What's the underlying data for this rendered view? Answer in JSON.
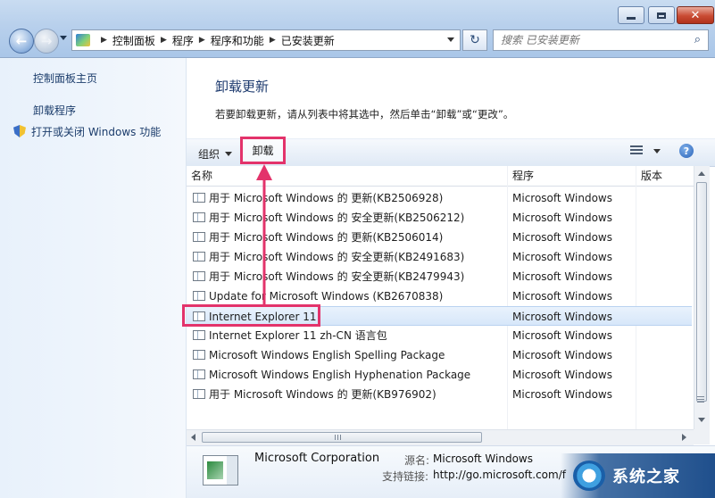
{
  "window": {
    "caption_buttons": [
      "minimize",
      "maximize",
      "close"
    ],
    "close_glyph": "✕"
  },
  "nav": {
    "back_icon": "back-arrow-icon",
    "forward_icon": "forward-arrow-icon",
    "breadcrumb": [
      "控制面板",
      "程序",
      "程序和功能",
      "已安装更新"
    ],
    "search_placeholder": "搜索 已安装更新"
  },
  "sidebar": {
    "items": [
      {
        "label": "控制面板主页"
      },
      {
        "label": "卸载程序"
      },
      {
        "label": "打开或关闭 Windows 功能",
        "icon": "shield-icon"
      }
    ]
  },
  "main": {
    "title": "卸载更新",
    "description": "若要卸载更新，请从列表中将其选中，然后单击“卸载”或“更改”。"
  },
  "toolbar": {
    "organize_label": "组织",
    "uninstall_label": "卸载",
    "help_glyph": "?"
  },
  "table": {
    "columns": [
      "名称",
      "程序",
      "版本"
    ],
    "rows": [
      {
        "name": "用于 Microsoft Windows 的 更新(KB2506928)",
        "program": "Microsoft Windows"
      },
      {
        "name": "用于 Microsoft Windows 的 安全更新(KB2506212)",
        "program": "Microsoft Windows"
      },
      {
        "name": "用于 Microsoft Windows 的 更新(KB2506014)",
        "program": "Microsoft Windows"
      },
      {
        "name": "用于 Microsoft Windows 的 安全更新(KB2491683)",
        "program": "Microsoft Windows"
      },
      {
        "name": "用于 Microsoft Windows 的 安全更新(KB2479943)",
        "program": "Microsoft Windows"
      },
      {
        "name": "Update for Microsoft Windows (KB2670838)",
        "program": "Microsoft Windows"
      },
      {
        "name": "Internet Explorer 11",
        "program": "Microsoft Windows",
        "selected": true
      },
      {
        "name": "Internet Explorer 11 zh-CN 语言包",
        "program": "Microsoft Windows"
      },
      {
        "name": "Microsoft Windows English Spelling Package",
        "program": "Microsoft Windows"
      },
      {
        "name": "Microsoft Windows English Hyphenation Package",
        "program": "Microsoft Windows"
      },
      {
        "name": "用于 Microsoft Windows 的 更新(KB976902)",
        "program": "Microsoft Windows"
      }
    ]
  },
  "details": {
    "company": "Microsoft Corporation",
    "source_label": "源名:",
    "source_value": "Microsoft Windows",
    "support_label": "支持链接:",
    "support_value": "http://go.microsoft.com/f"
  },
  "watermark": {
    "text": "系统之家"
  },
  "colors": {
    "highlight": "#e3336b",
    "title_blue": "#1e3b6f"
  }
}
